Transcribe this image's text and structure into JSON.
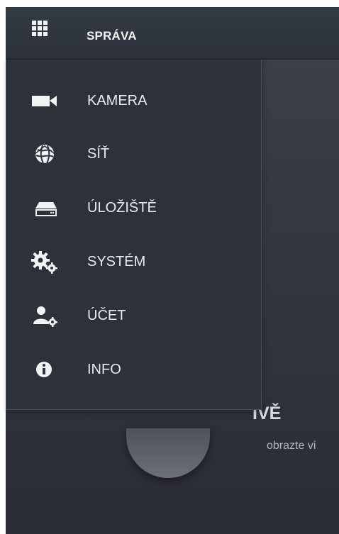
{
  "header": {
    "title": "SPRÁVA",
    "menu_icon": "grid-icon"
  },
  "menu": {
    "items": [
      {
        "label": "KAMERA",
        "icon": "camera-icon"
      },
      {
        "label": "SÍŤ",
        "icon": "network-globe-icon"
      },
      {
        "label": "ÚLOŽIŠTĚ",
        "icon": "storage-drive-icon"
      },
      {
        "label": "SYSTÉM",
        "icon": "gears-icon"
      },
      {
        "label": "ÚČET",
        "icon": "user-settings-icon"
      },
      {
        "label": "INFO",
        "icon": "info-icon"
      }
    ]
  },
  "background": {
    "live_title": "IVĚ",
    "live_subtitle": "obrazte vi"
  },
  "colors": {
    "header_bg": "#30353d",
    "menu_bg": "#2d3139",
    "text": "#e8eaee",
    "icon": "#f2f3f5"
  }
}
